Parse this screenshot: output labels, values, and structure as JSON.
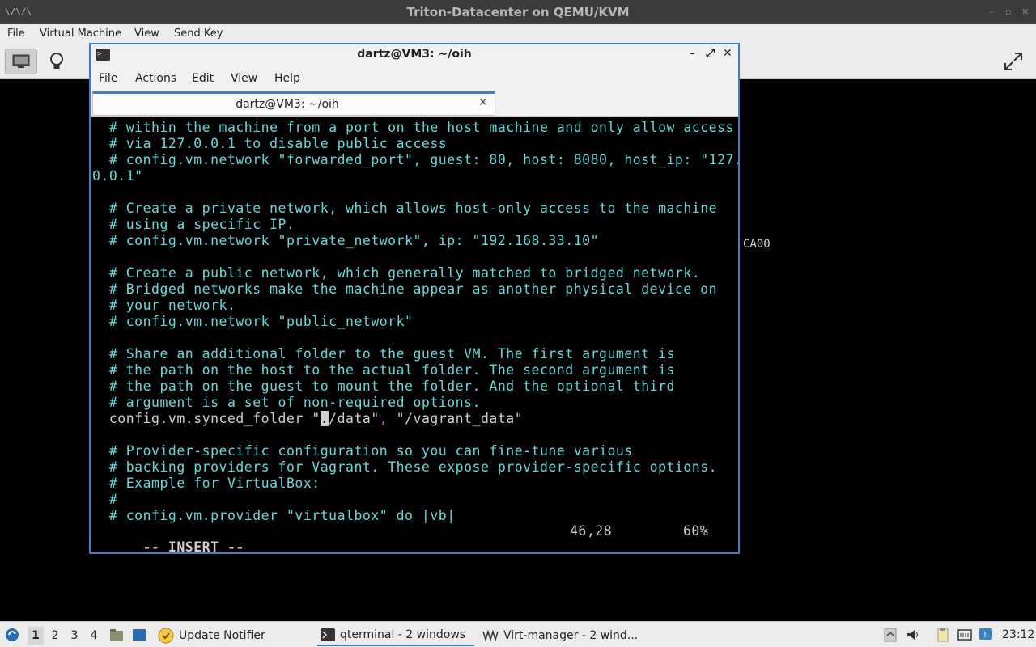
{
  "outer_window": {
    "title": "Triton-Datacenter on QEMU/KVM",
    "app_icon_text": "\\/\\/\\",
    "menu": [
      "File",
      "Virtual Machine",
      "View",
      "Send Key"
    ],
    "side_text": "CA00"
  },
  "terminal": {
    "title": "dartz@VM3: ~/oih",
    "tab_label": "dartz@VM3: ~/oih",
    "menu": [
      "File",
      "Actions",
      "Edit",
      "View",
      "Help"
    ],
    "lines": [
      {
        "kind": "comment",
        "text": "  # within the machine from a port on the host machine and only allow access"
      },
      {
        "kind": "comment",
        "text": "  # via 127.0.0.1 to disable public access"
      },
      {
        "kind": "comment",
        "text": "  # config.vm.network \"forwarded_port\", guest: 80, host: 8080, host_ip: \"127."
      },
      {
        "kind": "comment",
        "text": "0.0.1\""
      },
      {
        "kind": "blank",
        "text": ""
      },
      {
        "kind": "comment",
        "text": "  # Create a private network, which allows host-only access to the machine"
      },
      {
        "kind": "comment",
        "text": "  # using a specific IP."
      },
      {
        "kind": "comment",
        "text": "  # config.vm.network \"private_network\", ip: \"192.168.33.10\""
      },
      {
        "kind": "blank",
        "text": ""
      },
      {
        "kind": "comment",
        "text": "  # Create a public network, which generally matched to bridged network."
      },
      {
        "kind": "comment",
        "text": "  # Bridged networks make the machine appear as another physical device on"
      },
      {
        "kind": "comment",
        "text": "  # your network."
      },
      {
        "kind": "comment",
        "text": "  # config.vm.network \"public_network\""
      },
      {
        "kind": "blank",
        "text": ""
      },
      {
        "kind": "comment",
        "text": "  # Share an additional folder to the guest VM. The first argument is"
      },
      {
        "kind": "comment",
        "text": "  # the path on the host to the actual folder. The second argument is"
      },
      {
        "kind": "comment",
        "text": "  # the path on the guest to mount the folder. And the optional third"
      },
      {
        "kind": "comment",
        "text": "  # argument is a set of non-required options."
      },
      {
        "kind": "code",
        "pre": "  config.vm.synced_folder \"",
        "cursor": ".",
        "post": "/data\"",
        "sep": ", ",
        "post2": "\"/vagrant_data\""
      },
      {
        "kind": "blank",
        "text": ""
      },
      {
        "kind": "comment",
        "text": "  # Provider-specific configuration so you can fine-tune various"
      },
      {
        "kind": "comment",
        "text": "  # backing providers for Vagrant. These expose provider-specific options."
      },
      {
        "kind": "comment",
        "text": "  # Example for VirtualBox:"
      },
      {
        "kind": "comment",
        "text": "  #"
      },
      {
        "kind": "comment",
        "text": "  # config.vm.provider \"virtualbox\" do |vb|"
      }
    ],
    "status": {
      "mode": "-- INSERT --",
      "position": "46,28",
      "percent": "60%"
    }
  },
  "taskbar": {
    "workspaces": [
      "1",
      "2",
      "3",
      "4"
    ],
    "active_workspace": "1",
    "tasks": [
      {
        "label": "Update Notifier",
        "icon": "update-notifier-icon"
      },
      {
        "label": "qterminal - 2 windows",
        "icon": "terminal-icon"
      },
      {
        "label": "Virt-manager - 2 wind...",
        "icon": "virt-manager-icon"
      }
    ],
    "clock": "23:12"
  },
  "colors": {
    "accent": "#3d7fc1",
    "comment": "#6ad8d8",
    "code": "#d0d0d0",
    "symbol": "#cc55cc"
  }
}
